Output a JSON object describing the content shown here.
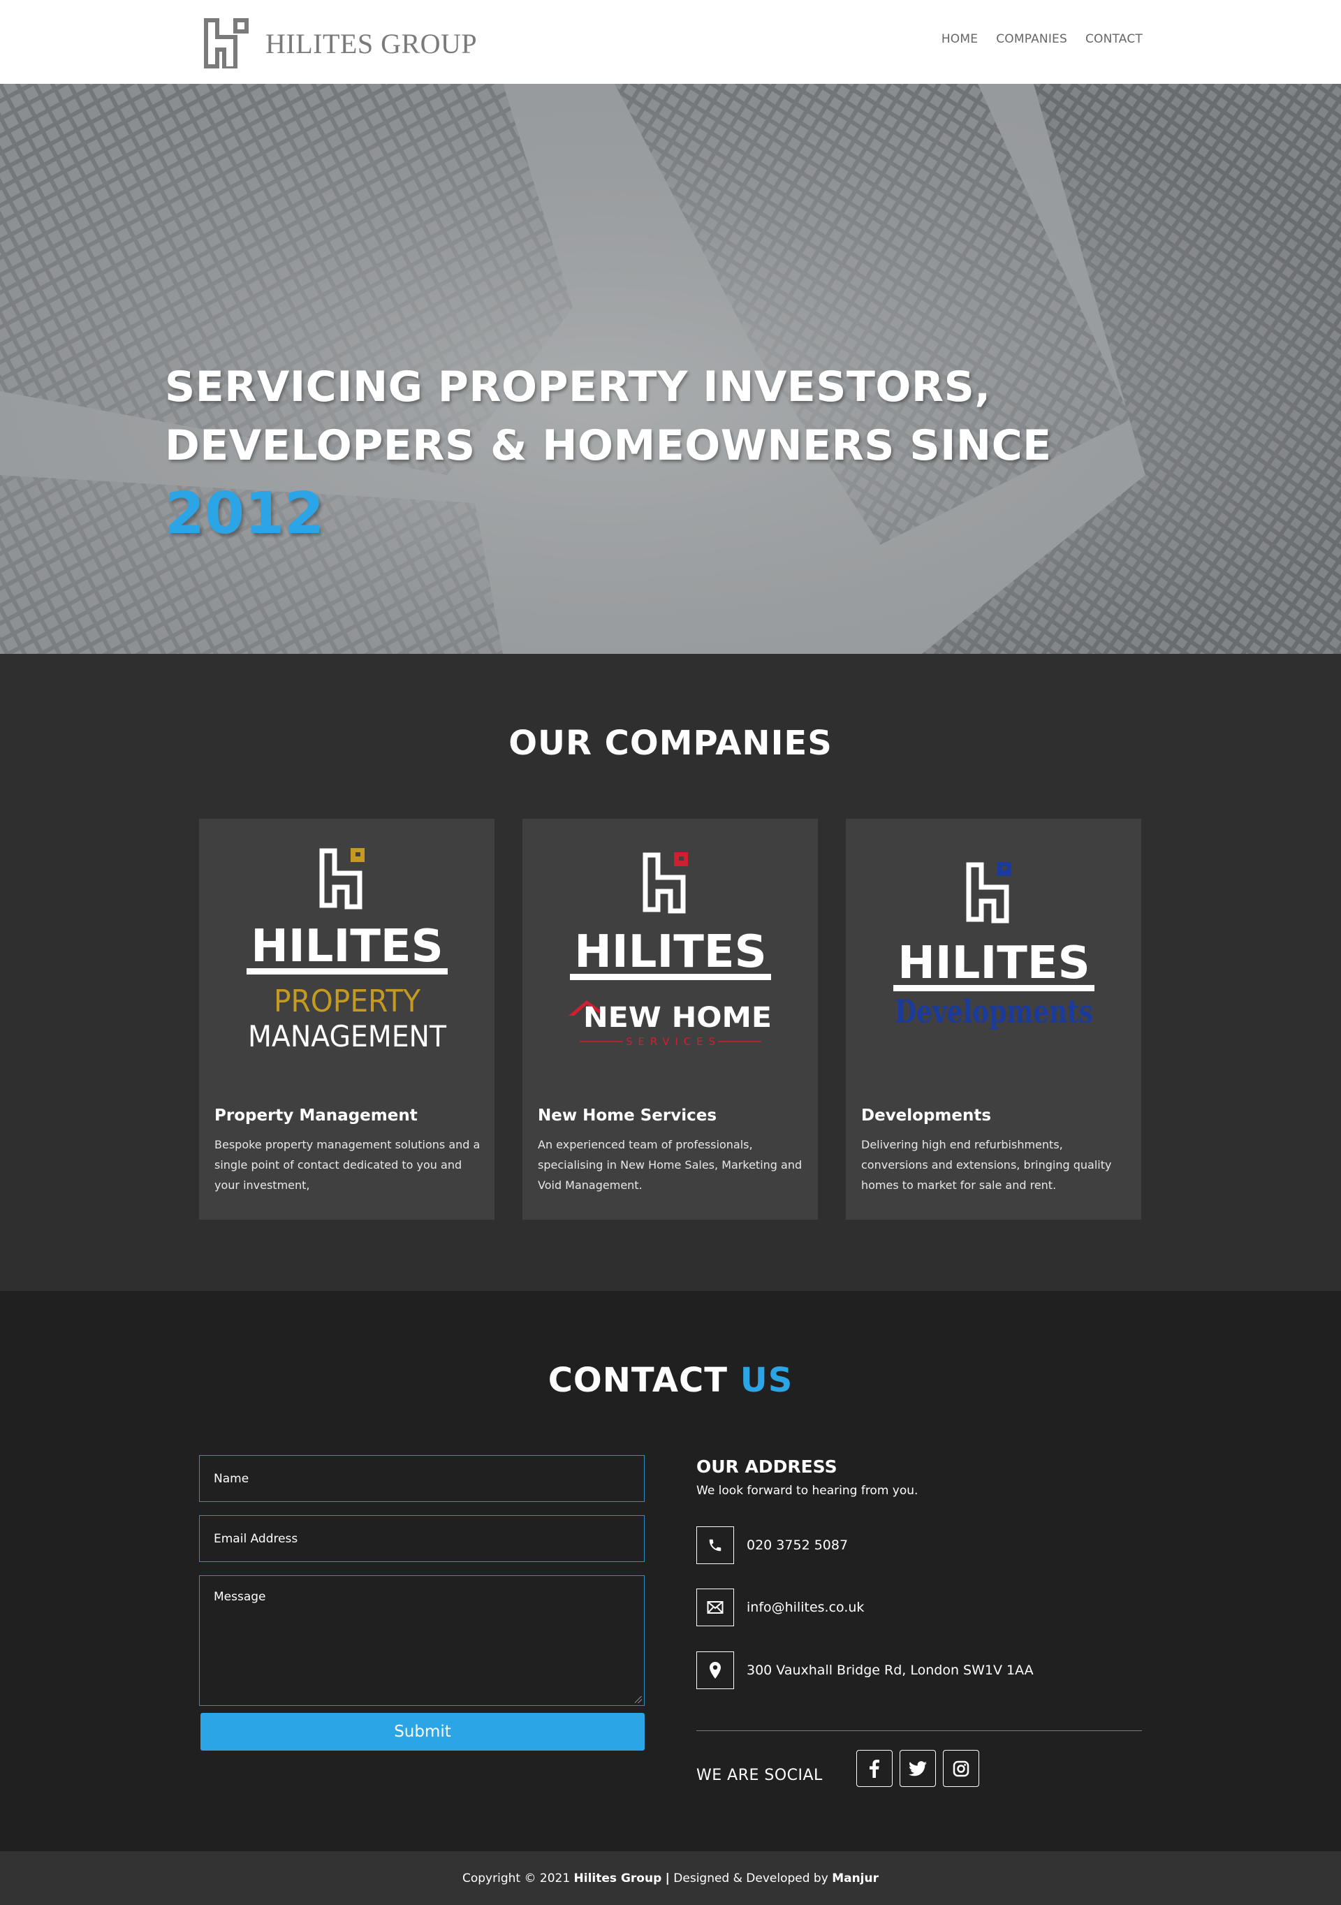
{
  "header": {
    "logo_text": "HILITES GROUP",
    "nav": [
      {
        "label": "HOME"
      },
      {
        "label": "COMPANIES"
      },
      {
        "label": "CONTACT"
      }
    ]
  },
  "hero": {
    "title_line1": "SERVICING PROPERTY INVESTORS,",
    "title_line2": "DEVELOPERS & HOMEOWNERS SINCE",
    "year": "2012",
    "accent_color": "#2ba5e5"
  },
  "companies": {
    "title": "OUR COMPANIES",
    "items": [
      {
        "logo_word": "HILITES",
        "logo_sub1": "PROPERTY",
        "logo_sub2": "MANAGEMENT",
        "logo_color": "#c49a22",
        "title": "Property Management",
        "description": "Bespoke property management solutions and a single point of contact dedicated to you and your investment,"
      },
      {
        "logo_word": "HILITES",
        "logo_sub1": "NEW HOME",
        "logo_sub2": "SERVICES",
        "logo_color": "#d01f2e",
        "title": "New Home Services",
        "description": "An experienced team of professionals, specialising in New Home Sales, Marketing and Void Management."
      },
      {
        "logo_word": "HILITES",
        "logo_sub1": "Developments",
        "logo_color": "#1a3a9c",
        "title": "Developments",
        "description": "Delivering high end refurbishments, conversions and extensions, bringing quality homes to market for sale and rent."
      }
    ]
  },
  "contact": {
    "title_main": "CONTACT",
    "title_accent": "US",
    "form": {
      "name_placeholder": "Name",
      "email_placeholder": "Email Address",
      "message_placeholder": "Message",
      "submit_label": "Submit"
    },
    "address": {
      "title": "OUR ADDRESS",
      "subtitle": "We look forward to hearing from you.",
      "phone": "020 3752 5087",
      "email": "info@hilites.co.uk",
      "location": "300 Vauxhall Bridge Rd, London SW1V 1AA"
    },
    "social": {
      "label": "WE ARE SOCIAL",
      "icons": [
        "facebook-icon",
        "twitter-icon",
        "instagram-icon"
      ]
    }
  },
  "footer": {
    "copyright_prefix": "Copyright © 2021",
    "company": "Hilites Group",
    "separator": "|",
    "designed_by": "Designed & Developed by",
    "designer": "Manjur"
  }
}
